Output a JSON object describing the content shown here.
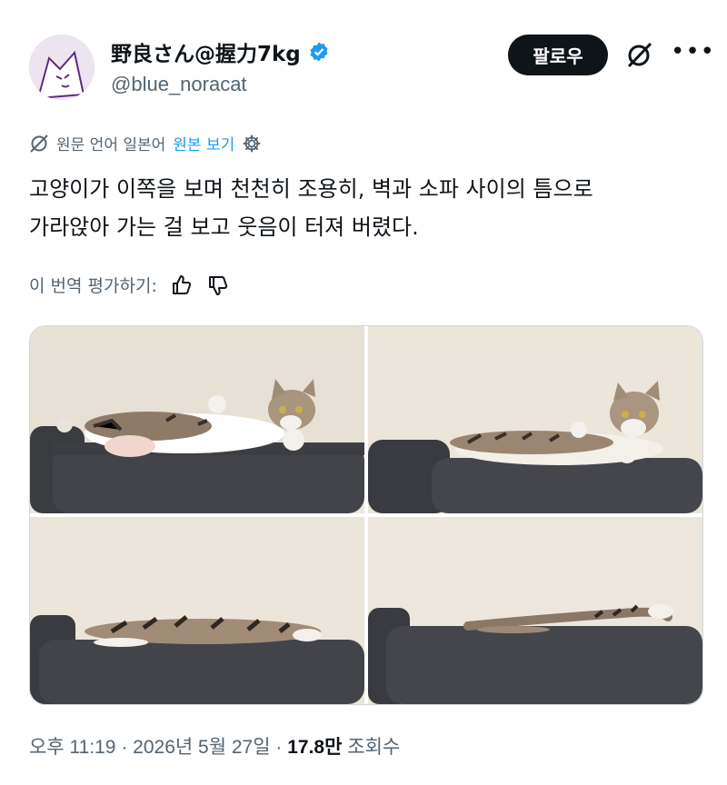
{
  "user": {
    "display_name": "野良さん@握力7kg",
    "handle": "@blue_noracat",
    "verified": true,
    "avatar_icon": "cat-face-avatar"
  },
  "actions": {
    "follow_label": "팔로우",
    "grok_icon": "slash-circle-icon",
    "more_icon": "more-icon"
  },
  "translation": {
    "original_language": "원문 언어 일본어",
    "view_original": "원본 보기",
    "settings_icon": "gear-icon"
  },
  "post": {
    "text_line1": "고양이가 이쪽을 보며 천천히 조용히, 벽과 소파 사이의 틈으로",
    "text_line2": "가라앉아 가는 걸 보고 웃음이 터져 버렸다."
  },
  "rate": {
    "label": "이 번역 평가하기:",
    "like_icon": "thumbs-up-icon",
    "dislike_icon": "thumbs-down-icon"
  },
  "footer": {
    "time": "오후 11:19",
    "date": "2026년 5월 27일",
    "views_count": "17.8만",
    "views_label": "조회수",
    "sep": "·"
  },
  "colors": {
    "accent": "#1d9bf0",
    "muted": "#536471",
    "text": "#0f1419"
  }
}
